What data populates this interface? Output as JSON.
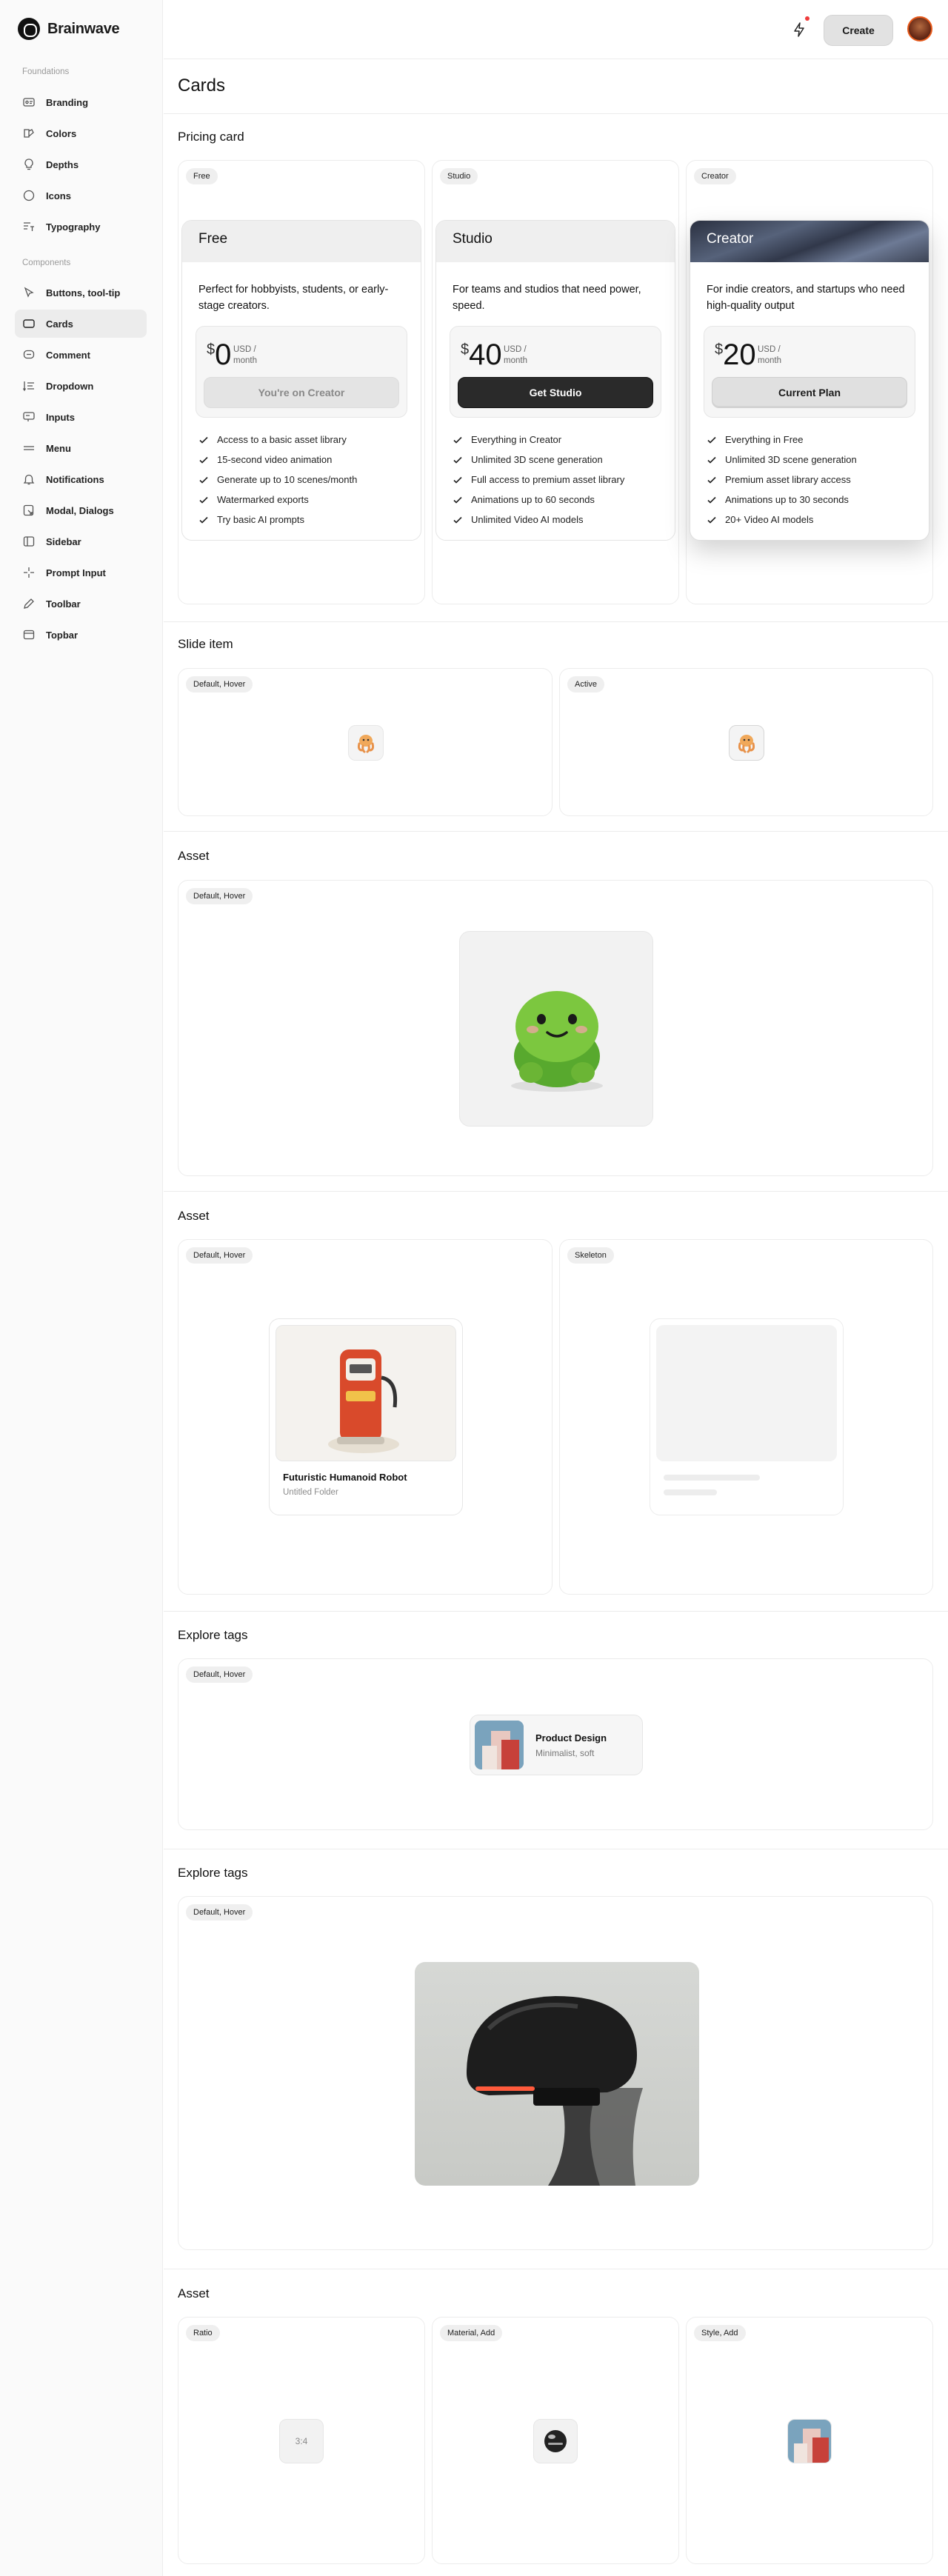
{
  "brand": {
    "name": "Brainwave"
  },
  "sidebar": {
    "foundations_label": "Foundations",
    "foundations": [
      {
        "label": "Branding",
        "icon": "branding-icon"
      },
      {
        "label": "Colors",
        "icon": "palette-icon"
      },
      {
        "label": "Depths",
        "icon": "lightbulb-icon"
      },
      {
        "label": "Icons",
        "icon": "circle-icon"
      },
      {
        "label": "Typography",
        "icon": "typography-icon"
      }
    ],
    "components_label": "Components",
    "components": [
      {
        "label": "Buttons, tool-tip",
        "icon": "cursor-icon"
      },
      {
        "label": "Cards",
        "icon": "card-icon",
        "active": true
      },
      {
        "label": "Comment",
        "icon": "comment-icon"
      },
      {
        "label": "Dropdown",
        "icon": "dropdown-icon"
      },
      {
        "label": "Inputs",
        "icon": "input-icon"
      },
      {
        "label": "Menu",
        "icon": "menu-icon"
      },
      {
        "label": "Notifications",
        "icon": "bell-icon"
      },
      {
        "label": "Modal, Dialogs",
        "icon": "modal-icon"
      },
      {
        "label": "Sidebar",
        "icon": "sidebar-icon"
      },
      {
        "label": "Prompt Input",
        "icon": "sparkle-icon"
      },
      {
        "label": "Toolbar",
        "icon": "pencil-icon"
      },
      {
        "label": "Topbar",
        "icon": "window-icon"
      }
    ]
  },
  "topbar": {
    "create_label": "Create"
  },
  "page": {
    "title": "Cards"
  },
  "sections": {
    "pricing": "Pricing card",
    "slide": "Slide item",
    "asset1": "Asset",
    "asset2": "Asset",
    "explore1": "Explore tags",
    "explore2": "Explore tags",
    "asset3": "Asset"
  },
  "pricing": [
    {
      "tag": "Free",
      "name": "Free",
      "desc": "Perfect for hobbyists, students, or early-stage creators.",
      "currency": "$",
      "amount": "0",
      "per": "USD / month",
      "button": "You're on Creator",
      "features": [
        "Access to a basic asset library",
        "15-second video animation",
        "Generate up to 10 scenes/month",
        "Watermarked exports",
        "Try basic AI prompts"
      ]
    },
    {
      "tag": "Studio",
      "name": "Studio",
      "desc": "For teams and studios that need power, speed.",
      "currency": "$",
      "amount": "40",
      "per": "USD / month",
      "button": "Get Studio",
      "features": [
        "Everything in Creator",
        "Unlimited 3D scene generation",
        "Full access to premium asset library",
        "Animations up to 60 seconds",
        "Unlimited Video AI models"
      ]
    },
    {
      "tag": "Creator",
      "name": "Creator",
      "desc": "For indie creators, and startups who need high-quality output",
      "currency": "$",
      "amount": "20",
      "per": "USD / month",
      "button": "Current Plan",
      "features": [
        "Everything in Free",
        "Unlimited 3D scene generation",
        "Premium asset library access",
        "Animations up to 30 seconds",
        "20+ Video AI models"
      ]
    }
  ],
  "slide": {
    "tags": [
      "Default, Hover",
      "Active"
    ]
  },
  "asset1": {
    "tag": "Default, Hover"
  },
  "asset2": {
    "tags": [
      "Default, Hover",
      "Skeleton"
    ],
    "title": "Futuristic Humanoid Robot",
    "subtitle": "Untitled Folder"
  },
  "explore1": {
    "tag": "Default, Hover",
    "title": "Product Design",
    "subtitle": "Minimalist, soft"
  },
  "explore2": {
    "tag": "Default, Hover"
  },
  "asset3": {
    "tags": [
      "Ratio",
      "Material, Add",
      "Style, Add"
    ],
    "ratio": "3:4"
  }
}
